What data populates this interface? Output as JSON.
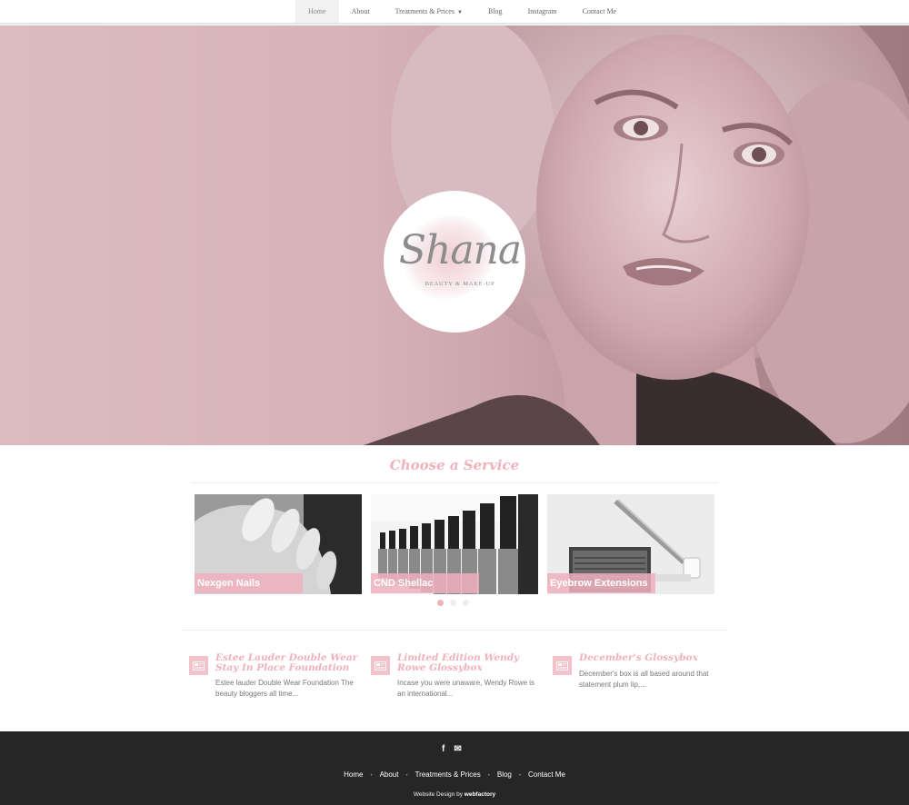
{
  "nav": {
    "items": [
      {
        "label": "Home",
        "active": true
      },
      {
        "label": "About"
      },
      {
        "label": "Treatments & Prices",
        "dropdown": true
      },
      {
        "label": "Blog"
      },
      {
        "label": "Instagram"
      },
      {
        "label": "Contact Me"
      }
    ]
  },
  "hero": {
    "logo_script": "Shana",
    "logo_tagline": "BEAUTY & MAKE-UP"
  },
  "services": {
    "title": "Choose a Service",
    "cards": [
      {
        "label": "Nexgen Nails"
      },
      {
        "label": "CND Shellac"
      },
      {
        "label": "Eyebrow Extensions"
      }
    ],
    "active_slide": 1
  },
  "posts": [
    {
      "title": "Estee Lauder Double Wear Stay In Place Foundation",
      "excerpt": "Estee lauder Double Wear Foundation The beauty bloggers all time..."
    },
    {
      "title": "Limited Edition Wendy Rowe Glossybox",
      "excerpt": "Incase you were unaware, Wendy Rowe is an international..."
    },
    {
      "title": "December's Glossybox",
      "excerpt": "December's box is all based around that statement plum lip,..."
    }
  ],
  "footer": {
    "social": [
      "facebook-icon",
      "email-icon"
    ],
    "facebook_glyph": "f",
    "email_glyph": "✉",
    "nav": [
      "Home",
      "About",
      "Treatments & Prices",
      "Blog",
      "Contact Me"
    ],
    "credit_prefix": "Website Design by",
    "credit_brand": "webfactory"
  },
  "colors": {
    "accent": "#efb1bc",
    "hero_bg": "#d9b7bd",
    "footer_bg": "#262626"
  }
}
